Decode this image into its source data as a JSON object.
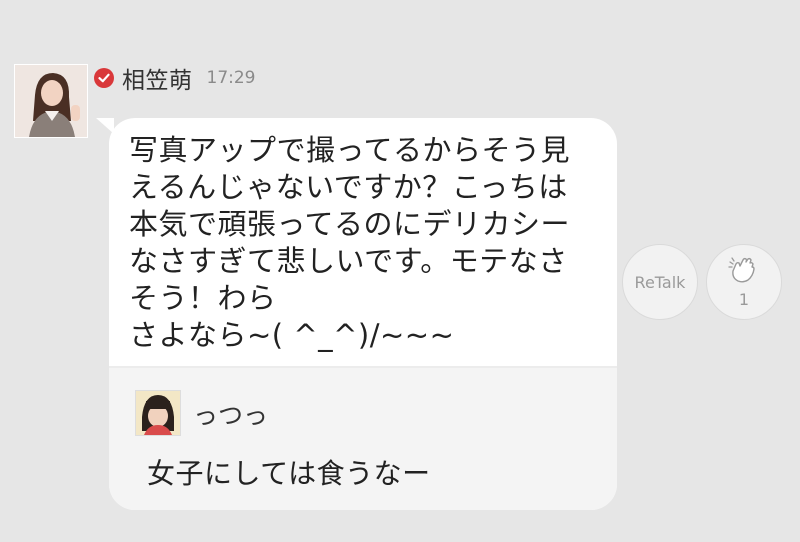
{
  "post": {
    "sender_name": "相笠萌",
    "time": "17:29",
    "message": "写真アップで撮ってるからそう見\nえるんじゃないですか？こっちは\n本気で頑張ってるのにデリカシー\nなさすぎて悲しいです。モテなさ\nそう！わら\nさよなら~( ^_^)/~~~"
  },
  "quoted": {
    "user_name": "っつっ",
    "comment": "女子にしては食うなー"
  },
  "actions": {
    "retalk_label": "ReTalk",
    "clap_count": "1"
  },
  "colors": {
    "background": "#e6e6e6",
    "verified_badge": "#d9383a",
    "bubble": "#ffffff"
  },
  "icons": [
    "verified-check-icon",
    "clap-hands-icon"
  ]
}
